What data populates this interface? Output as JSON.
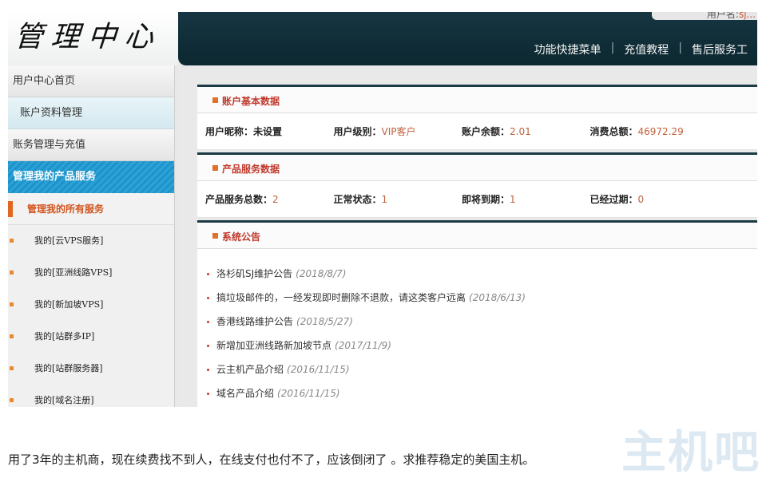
{
  "logo": {
    "text": "管理中心"
  },
  "header": {
    "user_box_prefix": "用户名:",
    "user_box_value": "sj...",
    "nav": [
      "功能快捷菜单",
      "充值教程",
      "售后服务工"
    ]
  },
  "sidebar": {
    "home": "用户中心首页",
    "account_profile": "账户资料管理",
    "finance": "账务管理与充值",
    "products_active": "管理我的产品服务",
    "current": "管理我的所有服务",
    "links": [
      "我的[云VPS服务]",
      "我的[亚洲线路VPS]",
      "我的[新加坡VPS]",
      "我的[站群多IP]",
      "我的[站群服务器]",
      "我的[域名注册]"
    ]
  },
  "account": {
    "title": "账户基本数据",
    "stats": [
      {
        "label": "用户昵称：",
        "value": "未设置",
        "plain": true
      },
      {
        "label": "用户级别：",
        "value": "VIP客户"
      },
      {
        "label": "账户余额：",
        "value": "2.01"
      },
      {
        "label": "消费总额：",
        "value": "46972.29"
      }
    ]
  },
  "products": {
    "title": "产品服务数据",
    "stats": [
      {
        "label": "产品服务总数：",
        "value": "2"
      },
      {
        "label": "正常状态：",
        "value": "1"
      },
      {
        "label": "即将到期：",
        "value": "1"
      },
      {
        "label": "已经过期：",
        "value": "0"
      }
    ]
  },
  "notices": {
    "title": "系统公告",
    "items": [
      {
        "title": "洛杉矶SJ维护公告",
        "date": "(2018/8/7)"
      },
      {
        "title": "搞垃圾邮件的，一经发现即时删除不退款，请这类客户远离",
        "date": "(2018/6/13)"
      },
      {
        "title": "香港线路维护公告",
        "date": "(2018/5/27)"
      },
      {
        "title": "新增加亚洲线路新加坡节点",
        "date": "(2017/11/9)"
      },
      {
        "title": "云主机产品介绍",
        "date": "(2016/11/15)"
      },
      {
        "title": "域名产品介绍",
        "date": "(2016/11/15)"
      }
    ]
  },
  "caption": "用了3年的主机商，现在续费找不到人，在线支付也付不了，应该倒闭了 。求推荐稳定的美国主机。",
  "watermark": "主机吧",
  "colors": {
    "header_bg": "#163642",
    "accent_red": "#c0392b",
    "sidebar_active": "#1f93c9",
    "value_color": "#c0603a"
  }
}
